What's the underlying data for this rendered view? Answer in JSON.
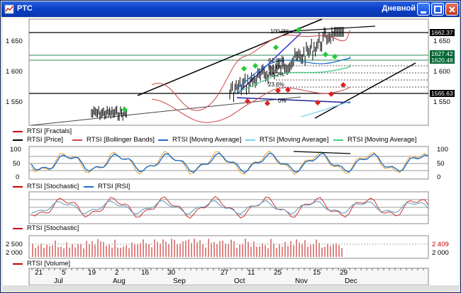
{
  "window": {
    "title": "РТС",
    "timeframe": "Дневной",
    "buttons": [
      "minimize",
      "maximize",
      "close"
    ]
  },
  "price_panel": {
    "y_ticks": [
      "1 650",
      "1 600",
      "1 550"
    ],
    "right_ticks": [
      "1 650",
      "1 600",
      "1 550"
    ],
    "flags": [
      {
        "text": "1662.37",
        "color": "#000000"
      },
      {
        "text": "1627.42",
        "color": "#006633"
      },
      {
        "text": "1620.48",
        "color": "#006633"
      },
      {
        "text": "1565.63",
        "color": "#000000"
      }
    ],
    "fib_labels": [
      "100.0%",
      "61.8%",
      "50.0%",
      "38.2%",
      "23.6%",
      "0%"
    ],
    "legend_row1": [
      {
        "text": "RTSI [Fractals]",
        "color": "#cc0000"
      }
    ],
    "legend_row2": [
      {
        "text": "RTSI [Price]",
        "color": "#000000"
      },
      {
        "text": "RTSI [Bollinger Bands]",
        "color": "#cc4444"
      },
      {
        "text": "RTSI [Moving Average]",
        "color": "#1f6fc7"
      },
      {
        "text": "RTSI [Moving Average]",
        "color": "#7fd4ef"
      },
      {
        "text": "RTSI [Moving Average]",
        "color": "#44cc88"
      }
    ]
  },
  "stoch_panel": {
    "y_ticks": [
      "100",
      "50",
      "0"
    ],
    "legend": [
      {
        "text": "RTSI [Stochastic]",
        "color": "#cc0000"
      },
      {
        "text": "RTSI [RSI]",
        "color": "#1f6fc7"
      }
    ]
  },
  "stoch2_panel": {
    "legend": [
      {
        "text": "RTSI [Stochastic]",
        "color": "#cc0000"
      }
    ]
  },
  "volume_panel": {
    "y_ticks": [
      "2 500",
      "2 000"
    ],
    "right_ticks": [
      "2 409",
      "2 000"
    ],
    "legend": [
      {
        "text": "RTSI [Volume]",
        "color": "#cc0000"
      }
    ]
  },
  "date_axis": {
    "days": [
      "21",
      "5",
      "19",
      "2",
      "16",
      "30",
      "27",
      "11",
      "25",
      "15",
      "29"
    ],
    "months": [
      "Jul",
      "Aug",
      "Sep",
      "Oct",
      "Nov",
      "Dec"
    ]
  }
}
